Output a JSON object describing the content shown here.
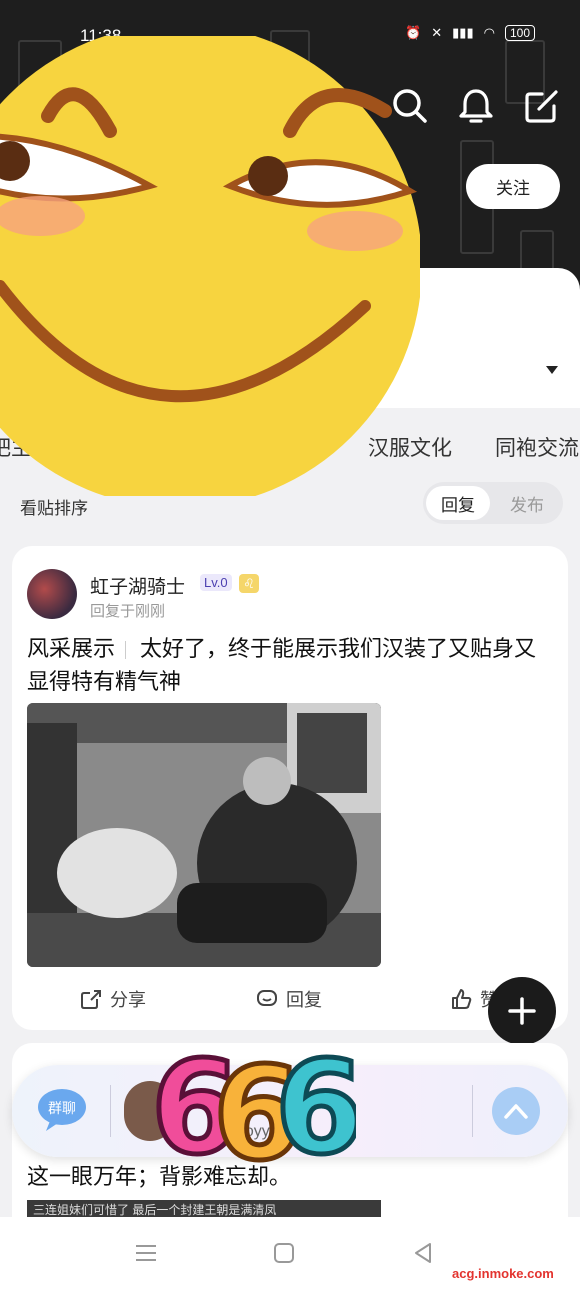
{
  "status": {
    "time": "11:38",
    "battery": "100"
  },
  "header": {
    "follow_label": "关注"
  },
  "tabs": [
    "吧主推荐",
    "汉服文化",
    "同袍交流"
  ],
  "sort": {
    "label": "看贴排序",
    "options": [
      "回复",
      "发布"
    ],
    "selected": "回复"
  },
  "post": {
    "username": "虹子湖骑士",
    "level": "Lv.0",
    "reply_meta": "回复于刚刚",
    "category": "风采展示",
    "text": "太好了，终于能展示我们汉装了又贴身又显得特有精气神",
    "actions": {
      "share": "分享",
      "reply": "回复",
      "like": "赞"
    }
  },
  "post2": {
    "line": "这一眼万年；背影难忘却。",
    "image_caption": "三连姐妹们可惜了 最后一个封建王朝是满清凤"
  },
  "chat": {
    "group_label": "群聊",
    "preview": "子]v:oyyfadg..."
  },
  "sticker_text": "666",
  "watermark": "acg.inmoke.com",
  "colors": {
    "header_bg": "#1e1e1e",
    "fab_bg": "#1b1b1b",
    "emoji_yellow": "#f7d43f",
    "accent_red": "#e3342f"
  }
}
